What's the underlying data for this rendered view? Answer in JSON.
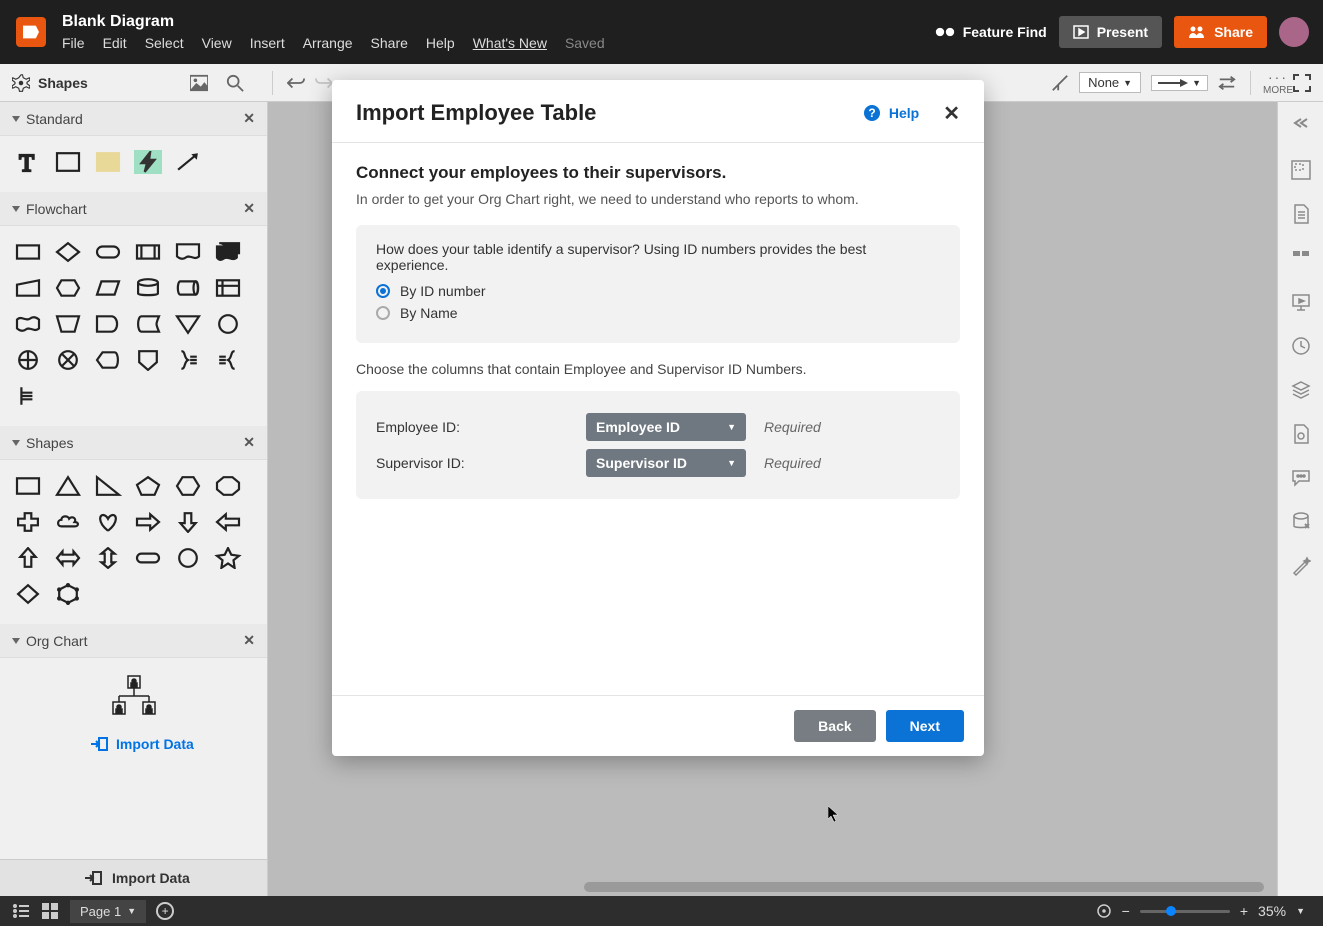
{
  "header": {
    "doc_title": "Blank Diagram",
    "menu": [
      "File",
      "Edit",
      "Select",
      "View",
      "Insert",
      "Arrange",
      "Share",
      "Help",
      "What's New",
      "Saved"
    ],
    "feature_find": "Feature Find",
    "present": "Present",
    "share": "Share"
  },
  "toolbar": {
    "shapes_label": "Shapes",
    "none_label": "None",
    "more_label": "MORE"
  },
  "panels": {
    "standard": "Standard",
    "flowchart": "Flowchart",
    "shapes": "Shapes",
    "org_chart": "Org Chart",
    "import_link": "Import Data",
    "import_bar": "Import Data"
  },
  "modal": {
    "title": "Import Employee Table",
    "help": "Help",
    "subtitle": "Connect your employees to their supervisors.",
    "description": "In order to get your Org Chart right, we need to understand who reports to whom.",
    "question": "How does your table identify a supervisor? Using ID numbers provides the best experience.",
    "radio_id": "By ID number",
    "radio_name": "By Name",
    "choose_text": "Choose the columns that contain Employee and Supervisor ID Numbers.",
    "employee_label": "Employee ID:",
    "employee_select": "Employee ID",
    "supervisor_label": "Supervisor ID:",
    "supervisor_select": "Supervisor ID",
    "required": "Required",
    "back": "Back",
    "next": "Next"
  },
  "bottom": {
    "page_tab": "Page 1",
    "zoom_pct": "35%"
  },
  "colors": {
    "accent": "#e8560f",
    "blue": "#0b72d6"
  }
}
